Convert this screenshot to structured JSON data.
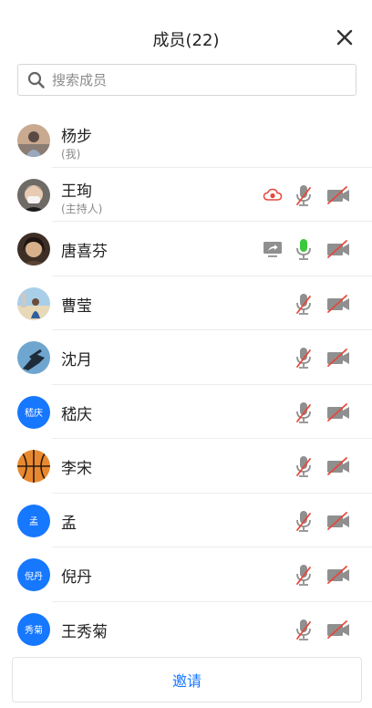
{
  "header": {
    "title": "成员(22)"
  },
  "search": {
    "placeholder": "搜索成员"
  },
  "members": [
    {
      "name": "杨步",
      "role": "(我)",
      "avatar": "photo-person",
      "controls": []
    },
    {
      "name": "王珣",
      "role": "(主持人)",
      "avatar": "photo-masked-person",
      "controls": [
        "cloud-recording-icon",
        "mic-muted-icon",
        "camera-off-icon"
      ]
    },
    {
      "name": "唐喜芬",
      "role": "",
      "avatar": "photo-portrait",
      "controls": [
        "screen-share-icon",
        "mic-active-icon",
        "camera-off-icon"
      ]
    },
    {
      "name": "曹莹",
      "role": "",
      "avatar": "photo-outdoor",
      "controls": [
        "mic-muted-icon",
        "camera-off-icon"
      ]
    },
    {
      "name": "沈月",
      "role": "",
      "avatar": "photo-sky",
      "controls": [
        "mic-muted-icon",
        "camera-off-icon"
      ]
    },
    {
      "name": "嵇庆",
      "role": "",
      "avatar_text": "嵇庆",
      "controls": [
        "mic-muted-icon",
        "camera-off-icon"
      ]
    },
    {
      "name": "李宋",
      "role": "",
      "avatar": "basketball",
      "controls": [
        "mic-muted-icon",
        "camera-off-icon"
      ]
    },
    {
      "name": "孟",
      "role": "",
      "avatar_text": "孟",
      "controls": [
        "mic-muted-icon",
        "camera-off-icon"
      ]
    },
    {
      "name": "倪丹",
      "role": "",
      "avatar_text": "倪丹",
      "controls": [
        "mic-muted-icon",
        "camera-off-icon"
      ]
    },
    {
      "name": "王秀菊",
      "role": "",
      "avatar_text": "秀菊",
      "controls": [
        "mic-muted-icon",
        "camera-off-icon"
      ]
    }
  ],
  "footer": {
    "invite_label": "邀请"
  },
  "colors": {
    "accent": "#1677ff",
    "muted_red": "#e5483c",
    "mic_active": "#3cc83c",
    "icon_gray": "#8f8f8f"
  }
}
